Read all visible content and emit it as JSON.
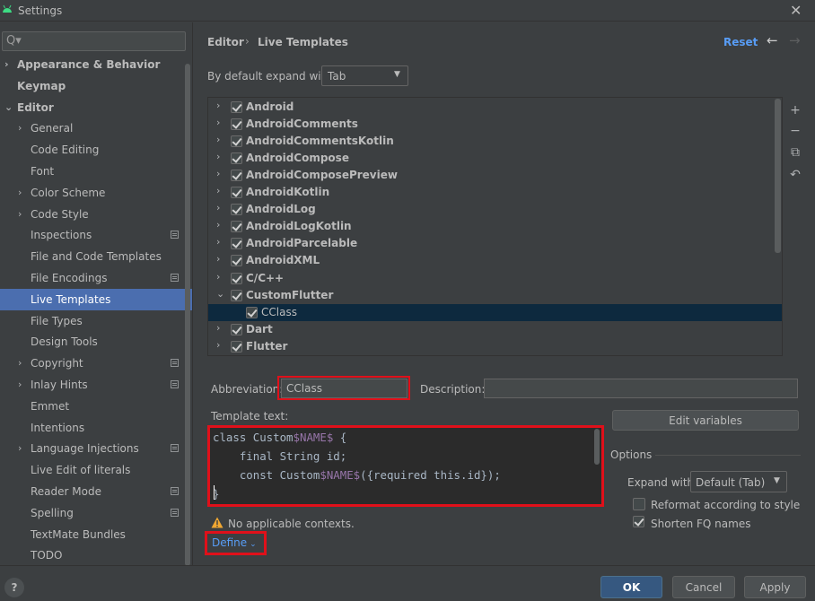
{
  "window": {
    "title": "Settings",
    "close_glyph": "✕",
    "logo_icon": "android-logo-icon"
  },
  "search": {
    "placeholder": "",
    "glyph": "Q▾"
  },
  "sidebar": {
    "items": [
      {
        "label": "Appearance & Behavior",
        "chev": "›",
        "bold": true
      },
      {
        "label": "Keymap",
        "chev": "",
        "bold": true
      },
      {
        "label": "Editor",
        "chev": "⌄",
        "bold": true
      },
      {
        "label": "General",
        "chev": "›"
      },
      {
        "label": "Code Editing",
        "chev": ""
      },
      {
        "label": "Font",
        "chev": ""
      },
      {
        "label": "Color Scheme",
        "chev": "›"
      },
      {
        "label": "Code Style",
        "chev": "›"
      },
      {
        "label": "Inspections",
        "chev": ""
      },
      {
        "label": "File and Code Templates",
        "chev": ""
      },
      {
        "label": "File Encodings",
        "chev": ""
      },
      {
        "label": "Live Templates",
        "chev": ""
      },
      {
        "label": "File Types",
        "chev": ""
      },
      {
        "label": "Design Tools",
        "chev": ""
      },
      {
        "label": "Copyright",
        "chev": "›"
      },
      {
        "label": "Inlay Hints",
        "chev": "›"
      },
      {
        "label": "Emmet",
        "chev": ""
      },
      {
        "label": "Intentions",
        "chev": ""
      },
      {
        "label": "Language Injections",
        "chev": "›"
      },
      {
        "label": "Live Edit of literals",
        "chev": ""
      },
      {
        "label": "Reader Mode",
        "chev": ""
      },
      {
        "label": "Spelling",
        "chev": ""
      },
      {
        "label": "TextMate Bundles",
        "chev": ""
      },
      {
        "label": "TODO",
        "chev": ""
      }
    ]
  },
  "header": {
    "crumb_editor": "Editor",
    "crumb_sep": "›",
    "crumb_live": "Live Templates",
    "reset": "Reset",
    "back": "←",
    "forward": "→"
  },
  "expand_default": {
    "label": "By default expand with",
    "value": "Tab",
    "arrow": "▼"
  },
  "tree": {
    "rows": [
      {
        "label": "Android",
        "chev": "›",
        "checked": true
      },
      {
        "label": "AndroidComments",
        "chev": "›",
        "checked": true
      },
      {
        "label": "AndroidCommentsKotlin",
        "chev": "›",
        "checked": true
      },
      {
        "label": "AndroidCompose",
        "chev": "›",
        "checked": true
      },
      {
        "label": "AndroidComposePreview",
        "chev": "›",
        "checked": true
      },
      {
        "label": "AndroidKotlin",
        "chev": "›",
        "checked": true
      },
      {
        "label": "AndroidLog",
        "chev": "›",
        "checked": true
      },
      {
        "label": "AndroidLogKotlin",
        "chev": "›",
        "checked": true
      },
      {
        "label": "AndroidParcelable",
        "chev": "›",
        "checked": true
      },
      {
        "label": "AndroidXML",
        "chev": "›",
        "checked": true
      },
      {
        "label": "C/C++",
        "chev": "›",
        "checked": true
      },
      {
        "label": "CustomFlutter",
        "chev": "⌄",
        "checked": true
      },
      {
        "label": "CClass",
        "chev": "",
        "checked": true
      },
      {
        "label": "Dart",
        "chev": "›",
        "checked": true
      },
      {
        "label": "Flutter",
        "chev": "›",
        "checked": true
      }
    ]
  },
  "toolbar": {
    "add": "+",
    "remove": "−",
    "copy": "⧉",
    "revert": "↶"
  },
  "form": {
    "abbreviation_label": "Abbreviation:",
    "abbreviation_value": "CClass",
    "description_label": "Description:",
    "description_value": "",
    "template_text_label": "Template text:",
    "edit_variables": "Edit variables",
    "options_label": "Options",
    "expand_with_label": "Expand with",
    "expand_with_value": "Default (Tab)",
    "expand_arrow": "▼",
    "reformat_label": "Reformat according to style",
    "shorten_label": "Shorten FQ names",
    "warning_text": "No applicable contexts.",
    "define_label": "Define"
  },
  "code": {
    "l1a": "class Custom",
    "l1v": "$NAME$",
    "l1b": " {",
    "l2": "    final String id;",
    "l3a": "    const Custom",
    "l3v": "$NAME$",
    "l3b": "({required this.id});",
    "l4": "}"
  },
  "buttons": {
    "help": "?",
    "ok": "OK",
    "cancel": "Cancel",
    "apply": "Apply"
  },
  "colors": {
    "accent": "#4b6eaf",
    "link": "#589df6",
    "highlight": "#e0101a",
    "selection": "#0d293e"
  }
}
